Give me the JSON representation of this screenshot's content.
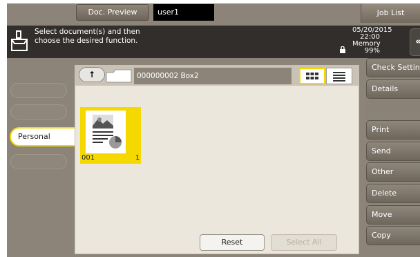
{
  "header": {
    "doc_preview_label": "Doc. Preview",
    "user": "user1",
    "job_list_label": "Job List"
  },
  "message": {
    "line1": "Select document(s) and then",
    "line2": "choose the desired function."
  },
  "status": {
    "date": "05/20/2015",
    "time": "22:00",
    "memory_label": "Memory",
    "memory_value": "99%"
  },
  "left_tabs": {
    "active_label": "Personal"
  },
  "box": {
    "title": "000000002 Box2"
  },
  "documents": [
    {
      "number": "001",
      "pages": "1"
    }
  ],
  "footer": {
    "reset_label": "Reset",
    "select_all_label": "Select All"
  },
  "right_menu": {
    "check_setting": "Check Setting",
    "details": "Details",
    "print": "Print",
    "send": "Send",
    "other": "Other",
    "delete": "Delete",
    "move": "Move",
    "copy": "Copy"
  },
  "colors": {
    "accent": "#f5d800",
    "bar": "#8c8479",
    "message_bg": "#312e2b"
  }
}
